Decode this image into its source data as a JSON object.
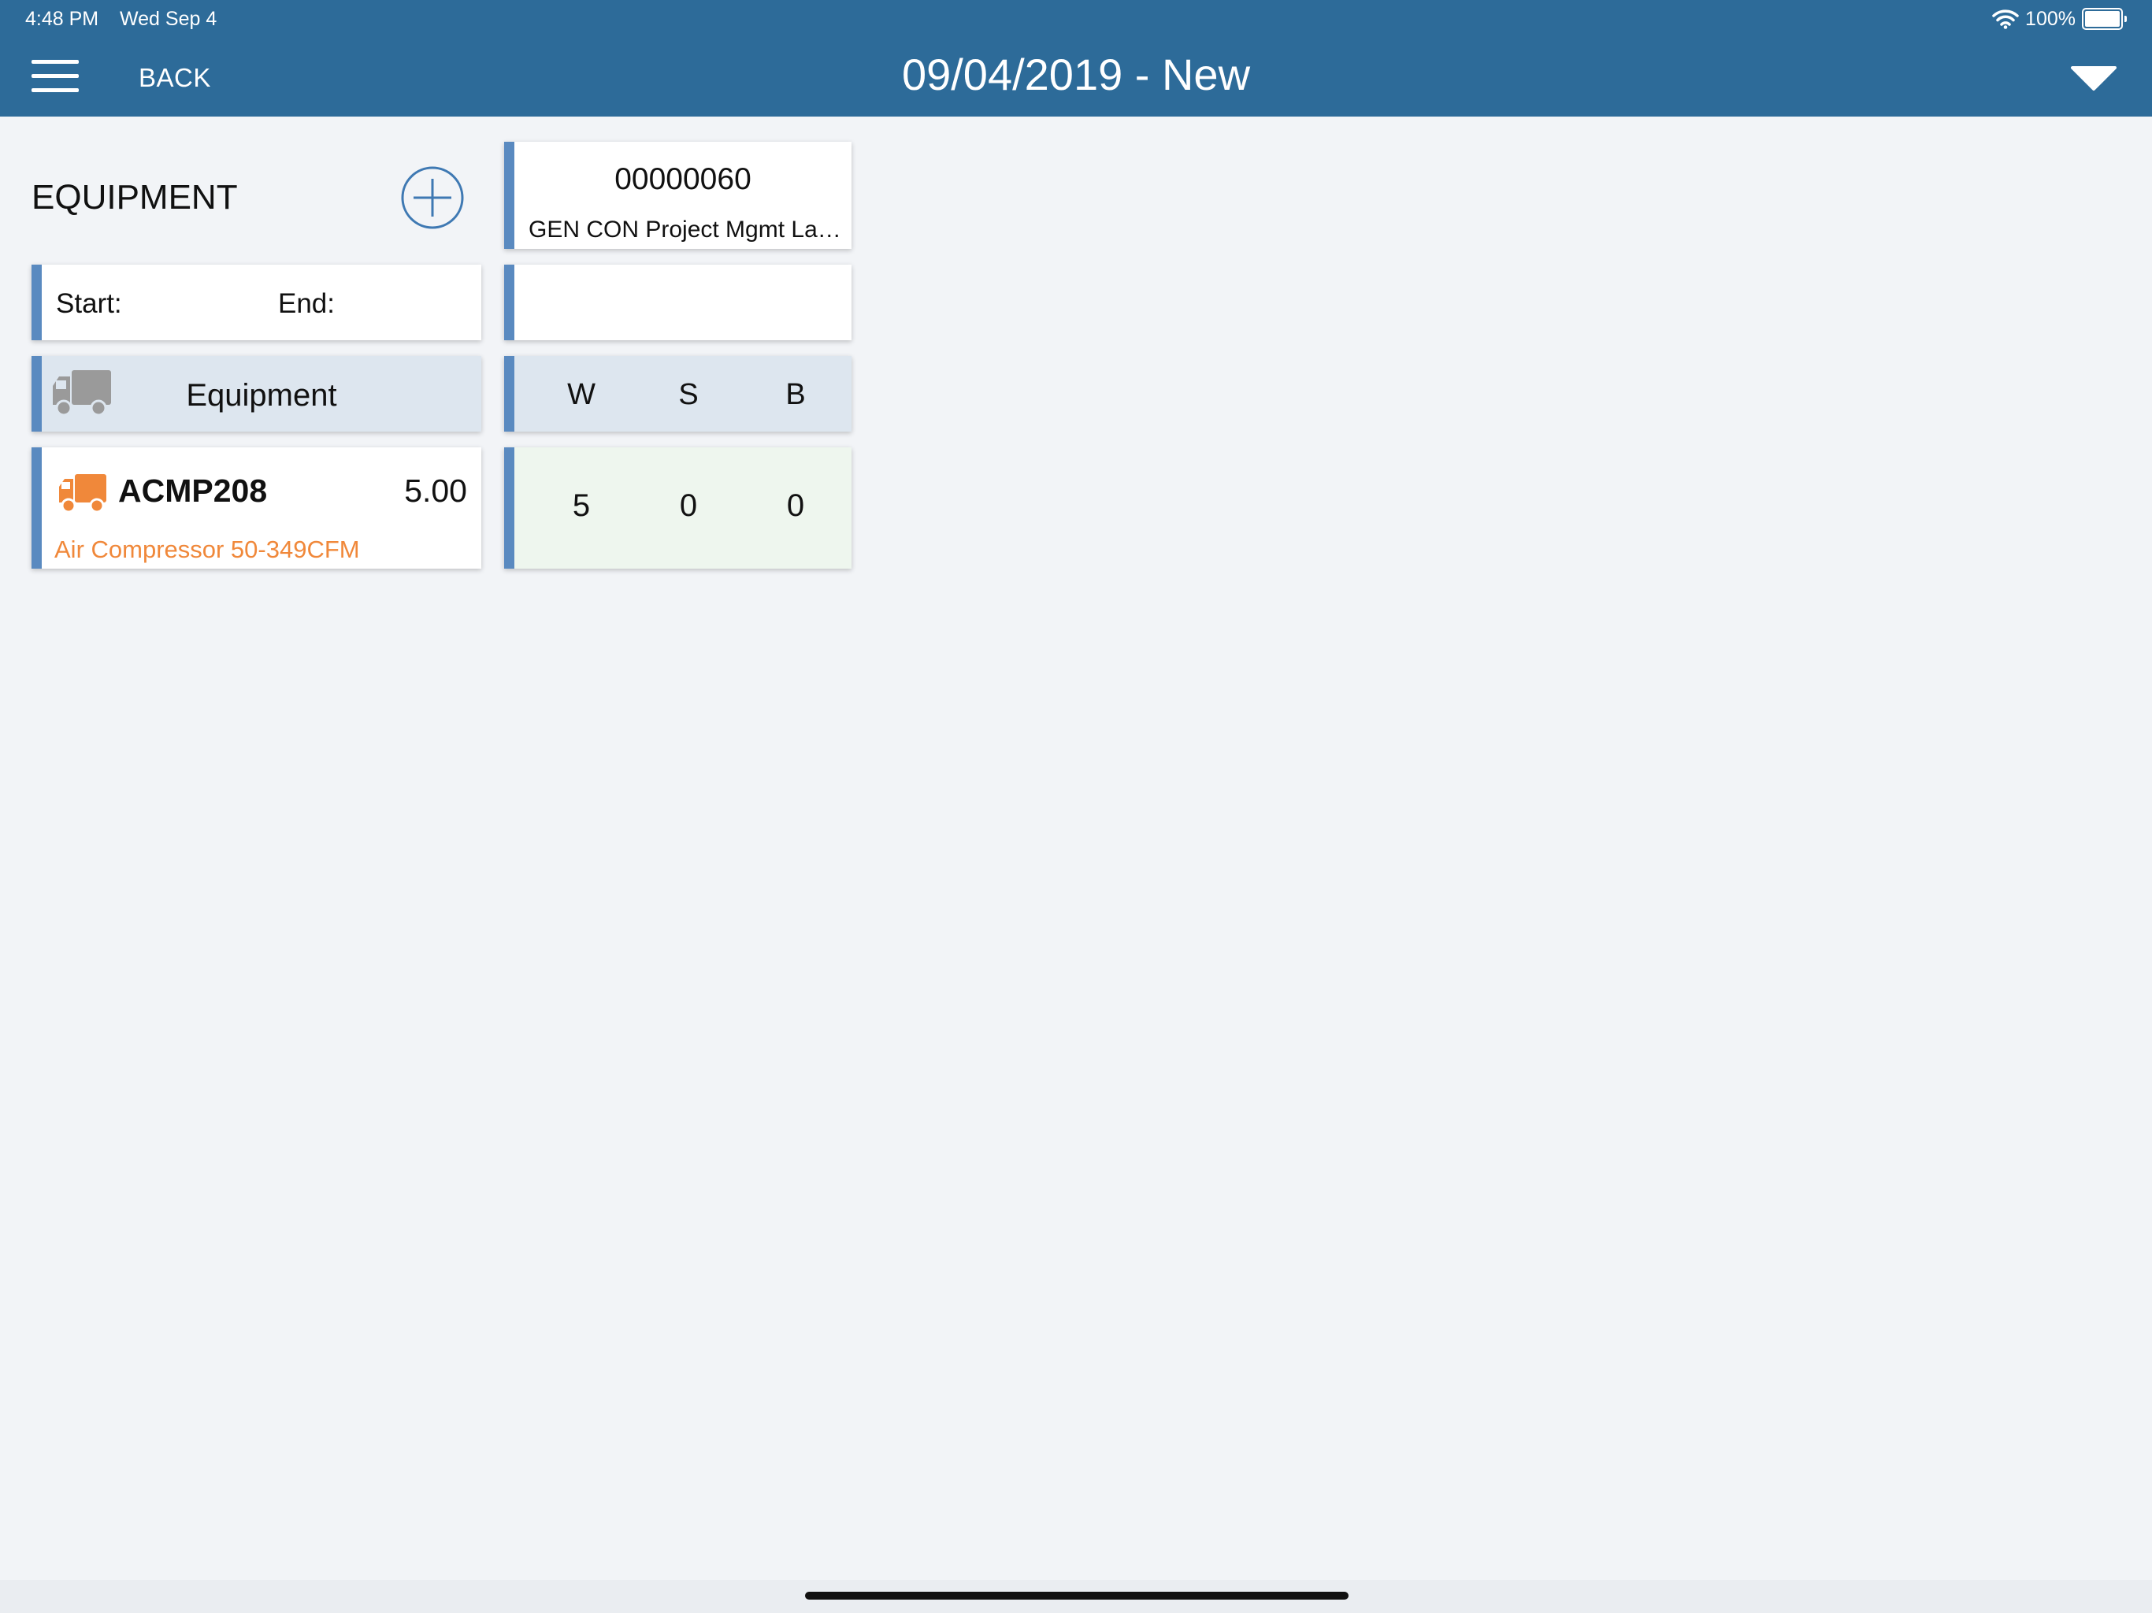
{
  "status_bar": {
    "time": "4:48 PM",
    "date": "Wed Sep 4",
    "battery": "100%"
  },
  "header": {
    "back_label": "BACK",
    "title": "09/04/2019 - New"
  },
  "section": {
    "title": "EQUIPMENT"
  },
  "job": {
    "number": "00000060",
    "description": "GEN CON Project Mgmt Labor"
  },
  "time_range": {
    "start_label": "Start:",
    "end_label": "End:"
  },
  "table_header": {
    "equipment_label": "Equipment",
    "columns": [
      "W",
      "S",
      "B"
    ]
  },
  "rows": [
    {
      "code": "ACMP208",
      "quantity": "5.00",
      "description": "Air Compressor 50-349CFM",
      "values": [
        "5",
        "0",
        "0"
      ]
    }
  ],
  "colors": {
    "brand": "#2d6b99",
    "accent_stripe": "#5a8ac0",
    "equipment_orange": "#f0883a",
    "background": "#f2f4f7"
  },
  "icons": {
    "menu": "hamburger-menu-icon",
    "dropdown": "triangle-down-icon",
    "add": "plus-circle-icon",
    "truck": "truck-icon"
  }
}
